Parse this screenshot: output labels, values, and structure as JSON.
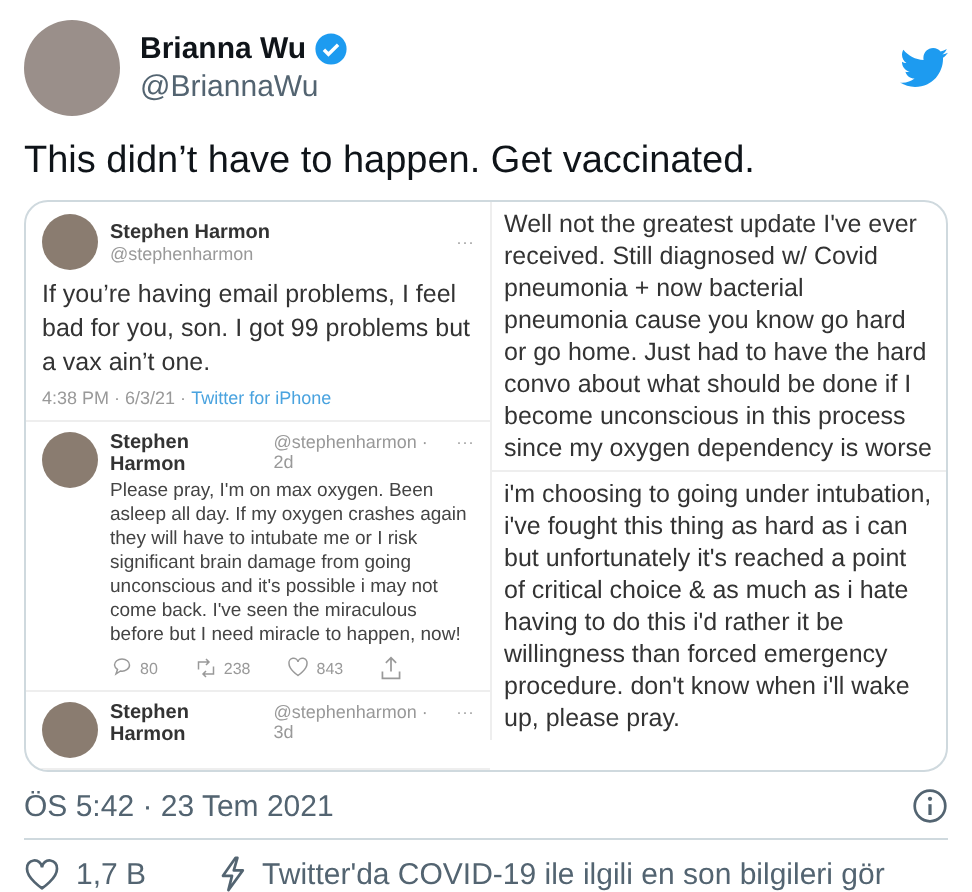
{
  "author": {
    "name": "Brianna Wu",
    "handle": "@BriannaWu",
    "verified": true
  },
  "text": "This didn’t have to happen. Get vaccinated.",
  "media": {
    "left": [
      {
        "kind": "tweet",
        "name": "Stephen Harmon",
        "handle": "@stephenharmon",
        "more": "···",
        "text": "If you’re having email problems, I feel bad for you, son. I got 99 problems but a vax ain’t one.",
        "meta": "4:38 PM · 6/3/21 · ",
        "source": "Twitter for iPhone"
      },
      {
        "kind": "reply",
        "name": "Stephen Harmon",
        "handle": "@stephenharmon · 2d",
        "more": "···",
        "text": "Please pray, I'm on max oxygen. Been asleep all day. If my oxygen crashes again they will have to intubate me or I risk significant brain damage from going unconscious and it's possible i may not come back. I've seen the miraculous before but I need miracle to happen, now!",
        "stats": [
          "80",
          "238",
          "843"
        ]
      },
      {
        "kind": "reply",
        "name": "Stephen Harmon",
        "handle": "@stephenharmon · 3d",
        "more": "···"
      }
    ],
    "right": [
      {
        "text": "Well not the greatest update I've ever received. Still diagnosed w/ Covid pneumonia + now bacterial pneumonia cause you know go hard or go home. Just had to have the hard convo about what should be done if I become unconscious in this process since my oxygen dependency is worse"
      },
      {
        "text": "i'm choosing to going under intubation, i've fought this thing as hard as i can but unfortunately it's reached a point of critical choice & as much as i hate having to do this i'd rather it be willingness than forced emergency procedure. don't know when i'll wake up, please pray."
      }
    ]
  },
  "timestamp": "ÖS 5:42 · 23 Tem 2021",
  "likes": "1,7 B",
  "covid_link": "Twitter'da COVID-19 ile ilgili en son bilgileri gör"
}
